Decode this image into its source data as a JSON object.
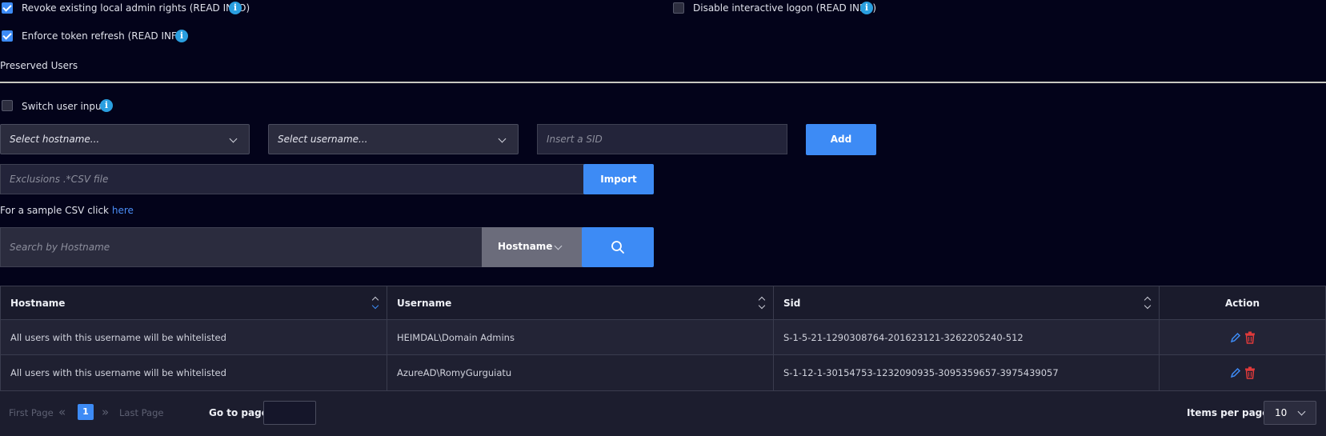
{
  "options": {
    "revoke_label": "Revoke existing local admin rights (READ INFO)",
    "revoke_checked": true,
    "disable_logon_label": "Disable interactive logon (READ INFO)",
    "disable_logon_checked": false,
    "token_refresh_label": "Enforce token refresh (READ INFO)",
    "token_refresh_checked": true
  },
  "section_title": "Preserved Users",
  "switch_input_label": "Switch user input",
  "switch_input_checked": false,
  "info_glyph": "i",
  "add_form": {
    "hostname_placeholder": "Select hostname...",
    "username_placeholder": "Select username...",
    "sid_placeholder": "Insert a SID",
    "add_label": "Add"
  },
  "import": {
    "file_placeholder": "Exclusions .*CSV file",
    "import_label": "Import",
    "sample_text": "For a sample CSV click",
    "sample_link": "here"
  },
  "search": {
    "placeholder": "Search by Hostname",
    "filter_value": "Hostname"
  },
  "table": {
    "headers": [
      "Hostname",
      "Username",
      "Sid",
      "Action"
    ],
    "rows": [
      {
        "hostname": "All users with this username will be whitelisted",
        "username": "HEIMDAL\\Domain Admins",
        "sid": "S-1-5-21-1290308764-201623121-3262205240-512"
      },
      {
        "hostname": "All users with this username will be whitelisted",
        "username": "AzureAD\\RomyGurguiatu",
        "sid": "S-1-12-1-30154753-1232090935-3095359657-3975439057"
      }
    ]
  },
  "pagination": {
    "first_page": "First Page",
    "last_page": "Last Page",
    "current_page": "1",
    "goto_label": "Go to page:",
    "items_per_page_label": "Items per page:",
    "items_per_page_value": "10"
  },
  "colors": {
    "background": "#03031a",
    "accent": "#3d8bf5",
    "info": "#2a9fe0",
    "delete": "#e03a3a"
  }
}
